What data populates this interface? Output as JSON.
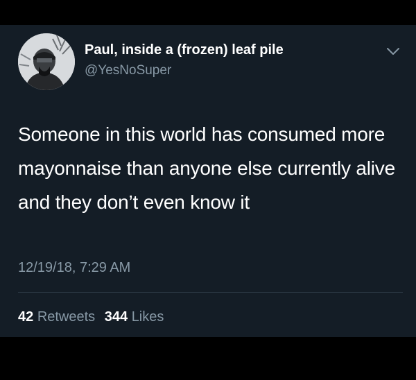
{
  "tweet": {
    "display_name": "Paul, inside a (frozen) leaf pile",
    "handle": "@YesNoSuper",
    "text": "Someone in this world has consumed more mayonnaise than anyone else currently alive and they don’t even know it",
    "timestamp": "12/19/18, 7:29 AM",
    "retweets_count": "42",
    "retweets_label": "Retweets",
    "likes_count": "344",
    "likes_label": "Likes"
  },
  "icons": {
    "menu": "chevron-down-icon",
    "avatar": "avatar"
  },
  "colors": {
    "background": "#000000",
    "card": "#141d26",
    "primary_text": "#ffffff",
    "secondary_text": "#8899a6",
    "divider": "#2f3b47"
  }
}
